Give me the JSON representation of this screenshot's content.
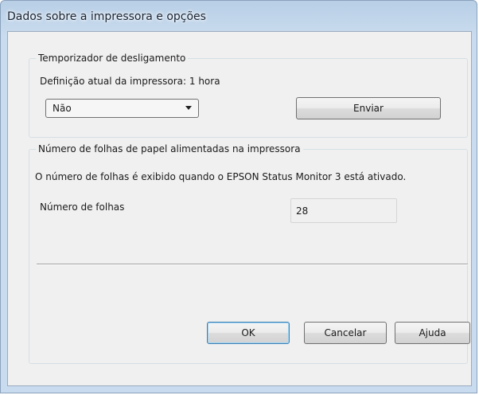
{
  "window": {
    "title": "Dados sobre a impressora e opções"
  },
  "shutdown_timer": {
    "group_label": "Temporizador de desligamento",
    "current_setting_text": "Definição atual da impressora: 1 hora",
    "dropdown_selected": "Não",
    "send_button": "Enviar"
  },
  "sheets": {
    "group_label": "Número de folhas de papel alimentadas na impressora",
    "info_text": "O número de folhas é exibido quando o EPSON Status Monitor 3 está ativado.",
    "count_label": "Número de folhas",
    "count_value": "28"
  },
  "footer": {
    "ok_button": "OK",
    "cancel_button": "Cancelar",
    "help_button": "Ajuda"
  }
}
